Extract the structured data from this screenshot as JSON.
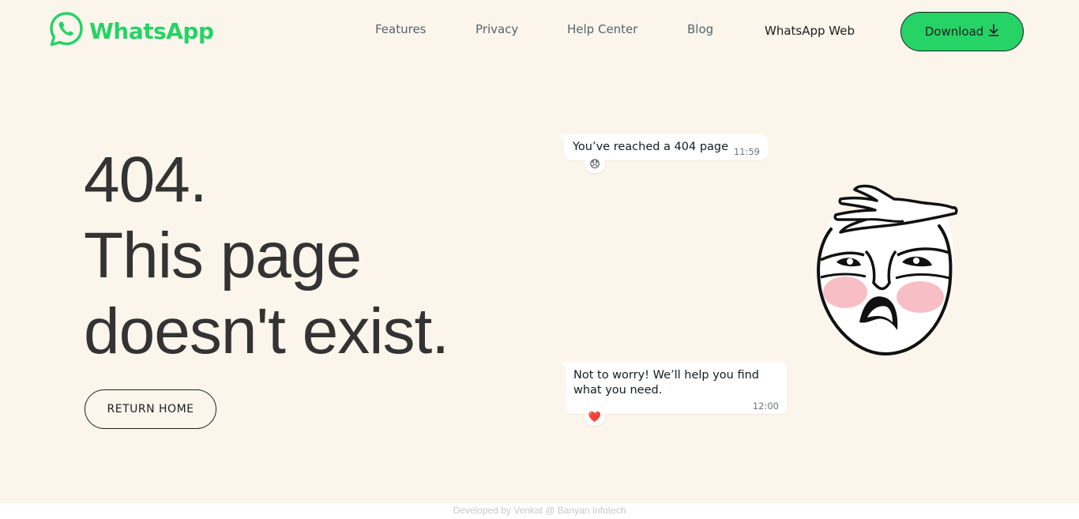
{
  "header": {
    "logo_text": "WhatsApp",
    "nav": [
      "Features",
      "Privacy",
      "Help Center",
      "Blog",
      "WhatsApp Web"
    ],
    "download_label": "Download"
  },
  "main": {
    "headline": [
      "404.",
      "This page",
      "doesn't exist."
    ],
    "return_label": "RETURN HOME"
  },
  "chat": {
    "message1": {
      "text": "You’ve reached a 404 page",
      "time": "11:59",
      "reaction": "😞"
    },
    "message2": {
      "text": "Not to worry! We’ll help you find what you need.",
      "time": "12:00",
      "reaction": "❤️"
    }
  },
  "footer": {
    "text": "Developed by Venkat @ Banyan Infotech"
  },
  "colors": {
    "brand": "#25d366",
    "background": "#fcf5eb",
    "text": "#333333"
  }
}
